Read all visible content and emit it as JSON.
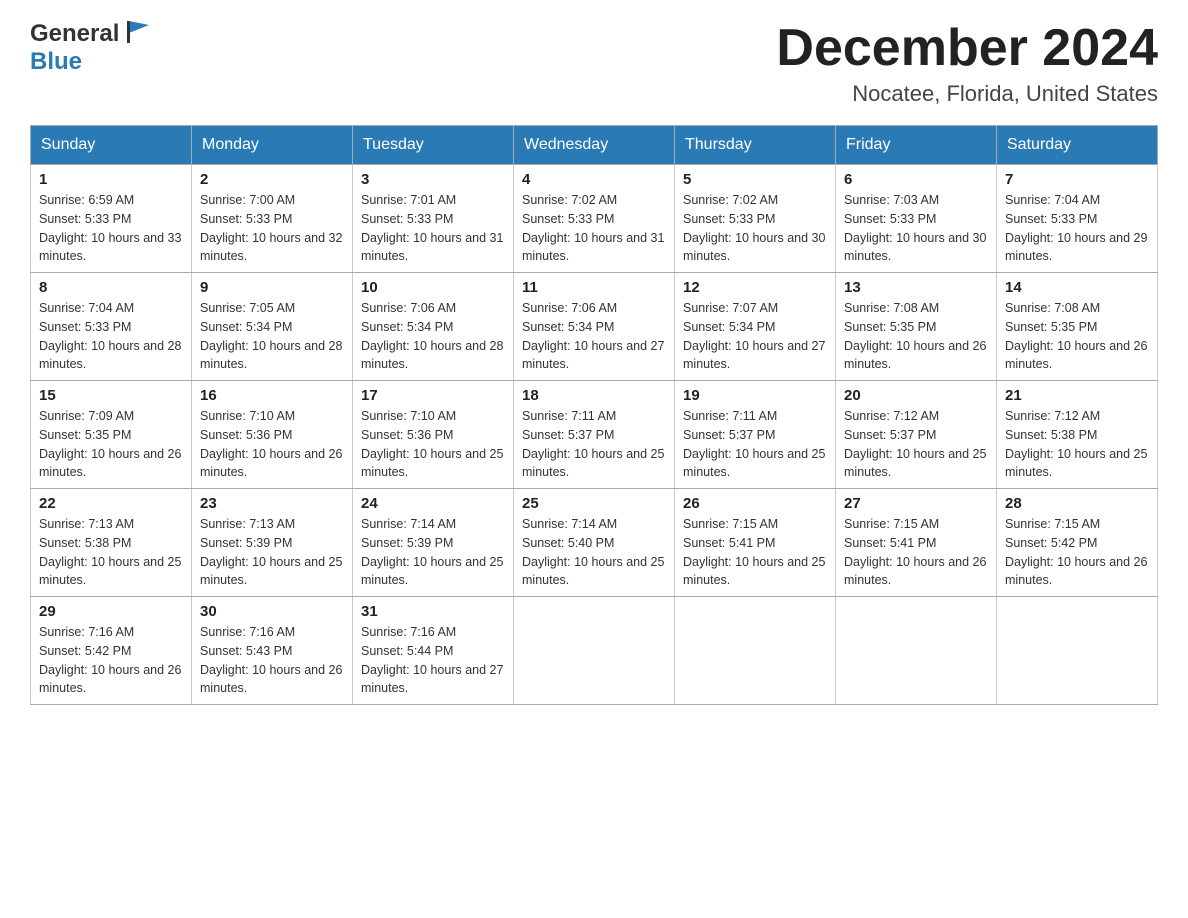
{
  "header": {
    "logo_general": "General",
    "logo_blue": "Blue",
    "month_title": "December 2024",
    "location": "Nocatee, Florida, United States"
  },
  "weekdays": [
    "Sunday",
    "Monday",
    "Tuesday",
    "Wednesday",
    "Thursday",
    "Friday",
    "Saturday"
  ],
  "weeks": [
    [
      {
        "day": "1",
        "sunrise": "6:59 AM",
        "sunset": "5:33 PM",
        "daylight": "10 hours and 33 minutes."
      },
      {
        "day": "2",
        "sunrise": "7:00 AM",
        "sunset": "5:33 PM",
        "daylight": "10 hours and 32 minutes."
      },
      {
        "day": "3",
        "sunrise": "7:01 AM",
        "sunset": "5:33 PM",
        "daylight": "10 hours and 31 minutes."
      },
      {
        "day": "4",
        "sunrise": "7:02 AM",
        "sunset": "5:33 PM",
        "daylight": "10 hours and 31 minutes."
      },
      {
        "day": "5",
        "sunrise": "7:02 AM",
        "sunset": "5:33 PM",
        "daylight": "10 hours and 30 minutes."
      },
      {
        "day": "6",
        "sunrise": "7:03 AM",
        "sunset": "5:33 PM",
        "daylight": "10 hours and 30 minutes."
      },
      {
        "day": "7",
        "sunrise": "7:04 AM",
        "sunset": "5:33 PM",
        "daylight": "10 hours and 29 minutes."
      }
    ],
    [
      {
        "day": "8",
        "sunrise": "7:04 AM",
        "sunset": "5:33 PM",
        "daylight": "10 hours and 28 minutes."
      },
      {
        "day": "9",
        "sunrise": "7:05 AM",
        "sunset": "5:34 PM",
        "daylight": "10 hours and 28 minutes."
      },
      {
        "day": "10",
        "sunrise": "7:06 AM",
        "sunset": "5:34 PM",
        "daylight": "10 hours and 28 minutes."
      },
      {
        "day": "11",
        "sunrise": "7:06 AM",
        "sunset": "5:34 PM",
        "daylight": "10 hours and 27 minutes."
      },
      {
        "day": "12",
        "sunrise": "7:07 AM",
        "sunset": "5:34 PM",
        "daylight": "10 hours and 27 minutes."
      },
      {
        "day": "13",
        "sunrise": "7:08 AM",
        "sunset": "5:35 PM",
        "daylight": "10 hours and 26 minutes."
      },
      {
        "day": "14",
        "sunrise": "7:08 AM",
        "sunset": "5:35 PM",
        "daylight": "10 hours and 26 minutes."
      }
    ],
    [
      {
        "day": "15",
        "sunrise": "7:09 AM",
        "sunset": "5:35 PM",
        "daylight": "10 hours and 26 minutes."
      },
      {
        "day": "16",
        "sunrise": "7:10 AM",
        "sunset": "5:36 PM",
        "daylight": "10 hours and 26 minutes."
      },
      {
        "day": "17",
        "sunrise": "7:10 AM",
        "sunset": "5:36 PM",
        "daylight": "10 hours and 25 minutes."
      },
      {
        "day": "18",
        "sunrise": "7:11 AM",
        "sunset": "5:37 PM",
        "daylight": "10 hours and 25 minutes."
      },
      {
        "day": "19",
        "sunrise": "7:11 AM",
        "sunset": "5:37 PM",
        "daylight": "10 hours and 25 minutes."
      },
      {
        "day": "20",
        "sunrise": "7:12 AM",
        "sunset": "5:37 PM",
        "daylight": "10 hours and 25 minutes."
      },
      {
        "day": "21",
        "sunrise": "7:12 AM",
        "sunset": "5:38 PM",
        "daylight": "10 hours and 25 minutes."
      }
    ],
    [
      {
        "day": "22",
        "sunrise": "7:13 AM",
        "sunset": "5:38 PM",
        "daylight": "10 hours and 25 minutes."
      },
      {
        "day": "23",
        "sunrise": "7:13 AM",
        "sunset": "5:39 PM",
        "daylight": "10 hours and 25 minutes."
      },
      {
        "day": "24",
        "sunrise": "7:14 AM",
        "sunset": "5:39 PM",
        "daylight": "10 hours and 25 minutes."
      },
      {
        "day": "25",
        "sunrise": "7:14 AM",
        "sunset": "5:40 PM",
        "daylight": "10 hours and 25 minutes."
      },
      {
        "day": "26",
        "sunrise": "7:15 AM",
        "sunset": "5:41 PM",
        "daylight": "10 hours and 25 minutes."
      },
      {
        "day": "27",
        "sunrise": "7:15 AM",
        "sunset": "5:41 PM",
        "daylight": "10 hours and 26 minutes."
      },
      {
        "day": "28",
        "sunrise": "7:15 AM",
        "sunset": "5:42 PM",
        "daylight": "10 hours and 26 minutes."
      }
    ],
    [
      {
        "day": "29",
        "sunrise": "7:16 AM",
        "sunset": "5:42 PM",
        "daylight": "10 hours and 26 minutes."
      },
      {
        "day": "30",
        "sunrise": "7:16 AM",
        "sunset": "5:43 PM",
        "daylight": "10 hours and 26 minutes."
      },
      {
        "day": "31",
        "sunrise": "7:16 AM",
        "sunset": "5:44 PM",
        "daylight": "10 hours and 27 minutes."
      },
      null,
      null,
      null,
      null
    ]
  ],
  "labels": {
    "sunrise_prefix": "Sunrise: ",
    "sunset_prefix": "Sunset: ",
    "daylight_prefix": "Daylight: "
  }
}
